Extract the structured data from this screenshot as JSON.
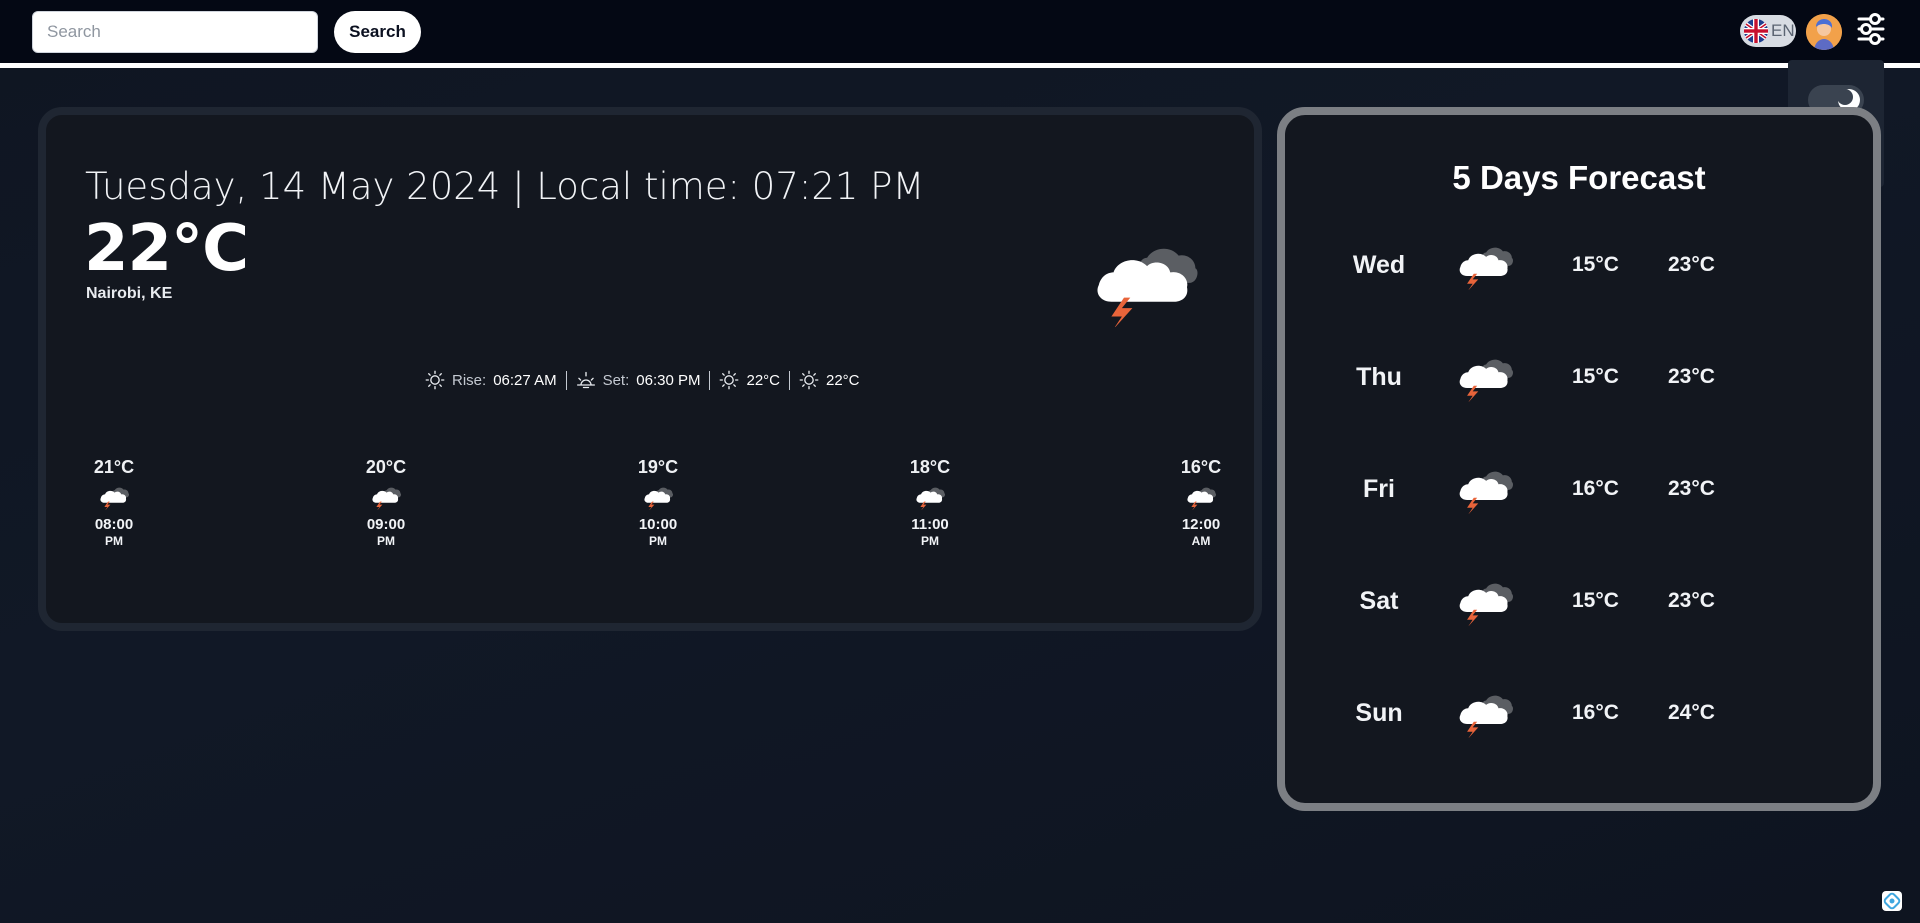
{
  "header": {
    "search_placeholder": "Search",
    "search_button": "Search",
    "language": "EN"
  },
  "settings": {
    "dark_mode_icon": "moon-icon",
    "unit_label": "°C"
  },
  "current": {
    "date_time": "Tuesday, 14 May 2024 | Local time: 07:21 PM",
    "temperature": "22°C",
    "location": "Nairobi, KE",
    "condition_icon": "thunderstorm-cloud-icon",
    "stats": [
      {
        "label": "Rise:",
        "value": "06:27 AM",
        "icon": "sunrise-icon"
      },
      {
        "label": "Set:",
        "value": "06:30 PM",
        "icon": "sunset-icon"
      },
      {
        "label": "",
        "value": "22°C",
        "icon": "sun-icon"
      },
      {
        "label": "",
        "value": "22°C",
        "icon": "sun-icon"
      }
    ]
  },
  "hourly": [
    {
      "temp": "21°C",
      "time": "08:00",
      "ampm": "PM"
    },
    {
      "temp": "20°C",
      "time": "09:00",
      "ampm": "PM"
    },
    {
      "temp": "19°C",
      "time": "10:00",
      "ampm": "PM"
    },
    {
      "temp": "18°C",
      "time": "11:00",
      "ampm": "PM"
    },
    {
      "temp": "16°C",
      "time": "12:00",
      "ampm": "AM"
    }
  ],
  "forecast": {
    "title": "5 Days Forecast",
    "days": [
      {
        "day": "Wed",
        "low": "15°C",
        "high": "23°C"
      },
      {
        "day": "Thu",
        "low": "15°C",
        "high": "23°C"
      },
      {
        "day": "Fri",
        "low": "16°C",
        "high": "23°C"
      },
      {
        "day": "Sat",
        "low": "15°C",
        "high": "23°C"
      },
      {
        "day": "Sun",
        "low": "16°C",
        "high": "24°C"
      }
    ]
  },
  "colors": {
    "background": "#111826",
    "topbar": "#040814",
    "card": "#13171f",
    "forecast_border": "#7c7f84",
    "bolt": "#e8643a"
  }
}
